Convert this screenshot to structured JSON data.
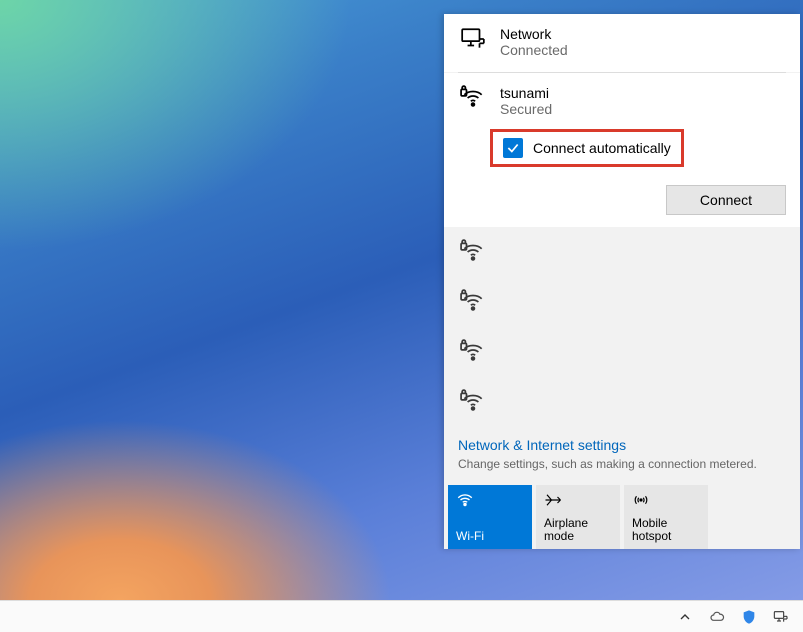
{
  "header": {
    "title": "Network",
    "status": "Connected"
  },
  "selected_network": {
    "ssid": "tsunami",
    "security": "Secured",
    "connect_automatically_label": "Connect automatically",
    "connect_automatically_checked": true,
    "connect_button": "Connect"
  },
  "other_networks": [
    {
      "ssid": ""
    },
    {
      "ssid": ""
    },
    {
      "ssid": ""
    },
    {
      "ssid": ""
    }
  ],
  "settings": {
    "link": "Network & Internet settings",
    "description": "Change settings, such as making a connection metered."
  },
  "tiles": {
    "wifi": "Wi-Fi",
    "airplane": "Airplane mode",
    "hotspot": "Mobile hotspot"
  }
}
